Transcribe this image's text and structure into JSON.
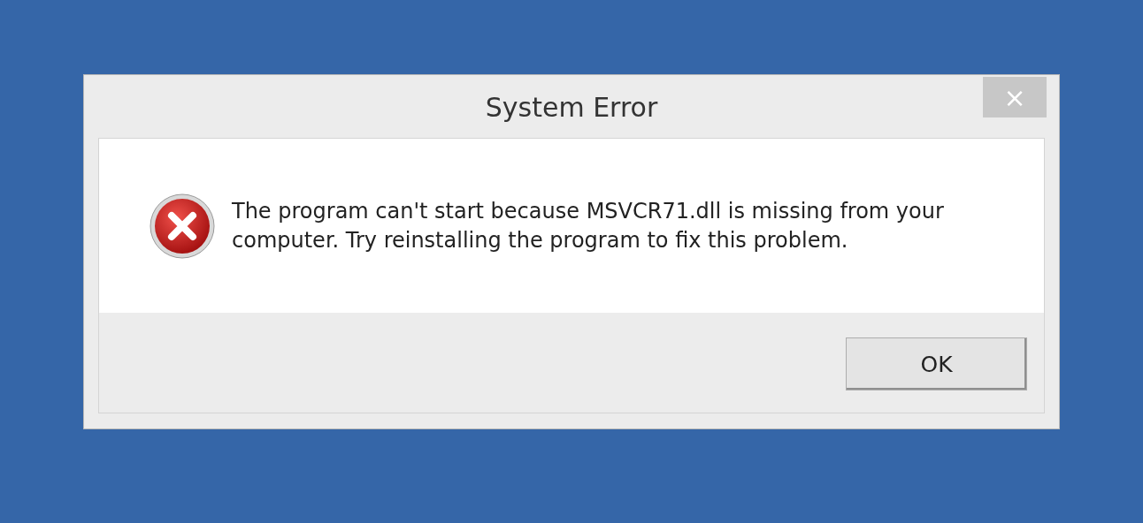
{
  "window": {
    "title": "System Error",
    "close": "×"
  },
  "message": {
    "kind": "error",
    "text": "The program can't start because MSVCR71.dll is missing from your computer. Try reinstalling the program to fix this problem."
  },
  "buttons": [
    "OK"
  ]
}
